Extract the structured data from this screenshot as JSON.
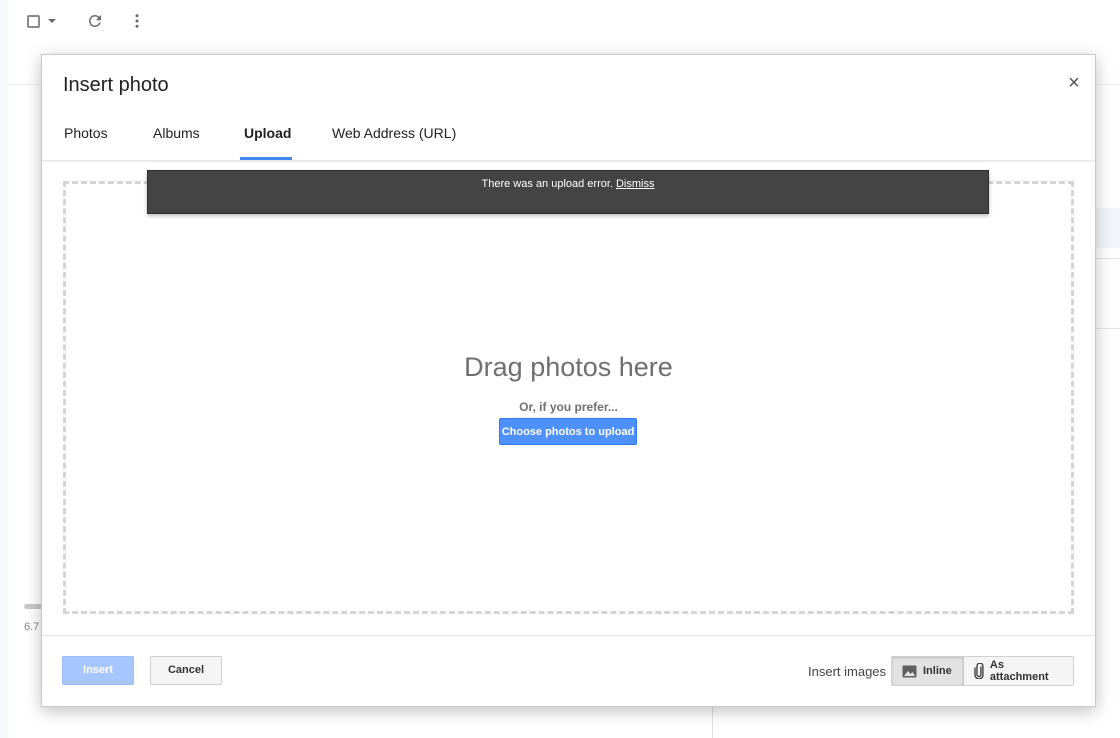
{
  "background": {
    "storage_text": "6.7"
  },
  "dialog": {
    "title": "Insert photo",
    "close_symbol": "×",
    "tabs": [
      {
        "label": "Photos",
        "active": false
      },
      {
        "label": "Albums",
        "active": false
      },
      {
        "label": "Upload",
        "active": true
      },
      {
        "label": "Web Address (URL)",
        "active": false
      }
    ],
    "error": {
      "message": "There was an upload error.",
      "dismiss_label": "Dismiss"
    },
    "dropzone": {
      "title": "Drag photos here",
      "prefer_text": "Or, if you prefer...",
      "choose_button": "Choose photos to upload"
    },
    "footer": {
      "insert_label": "Insert",
      "cancel_label": "Cancel",
      "insert_images_label": "Insert images",
      "inline_label": "Inline",
      "attachment_label": "As attachment",
      "selected_mode": "Inline"
    }
  },
  "icons": {
    "select_all": "checkbox-icon",
    "select_menu": "caret-down-icon",
    "refresh": "refresh-icon",
    "more": "more-vert-icon",
    "close": "close-icon",
    "inline": "image-icon",
    "attachment": "paperclip-icon"
  },
  "colors": {
    "accent": "#4d90fe",
    "tab_underline": "#4285f4",
    "insert_disabled": "#a7c6fd",
    "error_bar": "#444444"
  }
}
